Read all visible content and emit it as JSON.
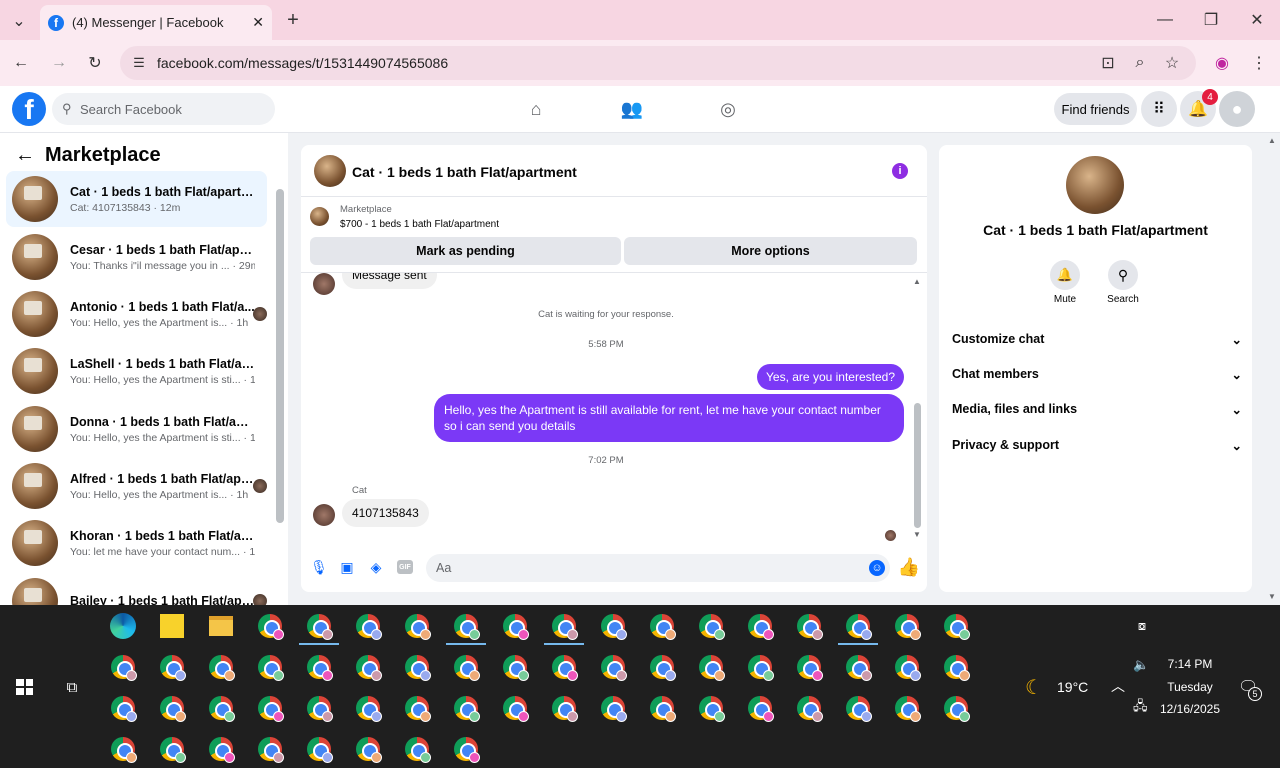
{
  "browser": {
    "tab_title": "(4) Messenger | Facebook",
    "url": "facebook.com/messages/t/1531449074565086"
  },
  "header": {
    "search_placeholder": "Search Facebook",
    "find_friends": "Find friends",
    "notif_count": "4"
  },
  "sidebar": {
    "title": "Marketplace",
    "items": [
      {
        "name": "Cat · 1 beds 1 bath Flat/apartment",
        "preview": "Cat: 4107135843 · 12m"
      },
      {
        "name": "Cesar · 1 beds 1 bath Flat/apart...",
        "preview": "You: Thanks i\"il message you in ... · 29m"
      },
      {
        "name": "Antonio · 1 beds 1 bath Flat/a...",
        "preview": "You: Hello, yes the Apartment is... · 1h"
      },
      {
        "name": "LaShell · 1 beds 1 bath Flat/apar...",
        "preview": "You: Hello, yes the Apartment is sti... · 1h"
      },
      {
        "name": "Donna · 1 beds 1 bath Flat/apart...",
        "preview": "You: Hello, yes the Apartment is sti... · 1h"
      },
      {
        "name": "Alfred · 1 beds 1 bath Flat/apa...",
        "preview": "You: Hello, yes the Apartment is... · 1h"
      },
      {
        "name": "Khoran · 1 beds 1 bath Flat/apar...",
        "preview": "You: let me have your contact num... · 1h"
      },
      {
        "name": "Bailey · 1 beds 1 bath Flat/apa...",
        "preview": ""
      }
    ]
  },
  "chat": {
    "title": "Cat · 1 beds 1 bath Flat/apartment",
    "marketplace_label": "Marketplace",
    "listing": "$700 - 1 beds 1 bath Flat/apartment",
    "mark_pending": "Mark as pending",
    "more_options": "More options",
    "partial_msg": "Message sent",
    "waiting": "Cat is waiting for your response.",
    "time1": "5:58 PM",
    "msg_out1": "Yes, are you interested?",
    "msg_out2": "Hello, yes the Apartment is still available for rent, let me have your contact number so i can send you details",
    "time2": "7:02 PM",
    "sender": "Cat",
    "msg_in": "4107135843",
    "input_placeholder": "Aa"
  },
  "details": {
    "name": "Cat · 1 beds 1 bath Flat/apartment",
    "mute": "Mute",
    "search": "Search",
    "options": [
      "Customize chat",
      "Chat members",
      "Media, files and links",
      "Privacy & support"
    ]
  },
  "taskbar": {
    "weather": "19°C",
    "time": "7:14 PM",
    "day": "Tuesday",
    "date": "12/16/2025",
    "notif": "5"
  }
}
